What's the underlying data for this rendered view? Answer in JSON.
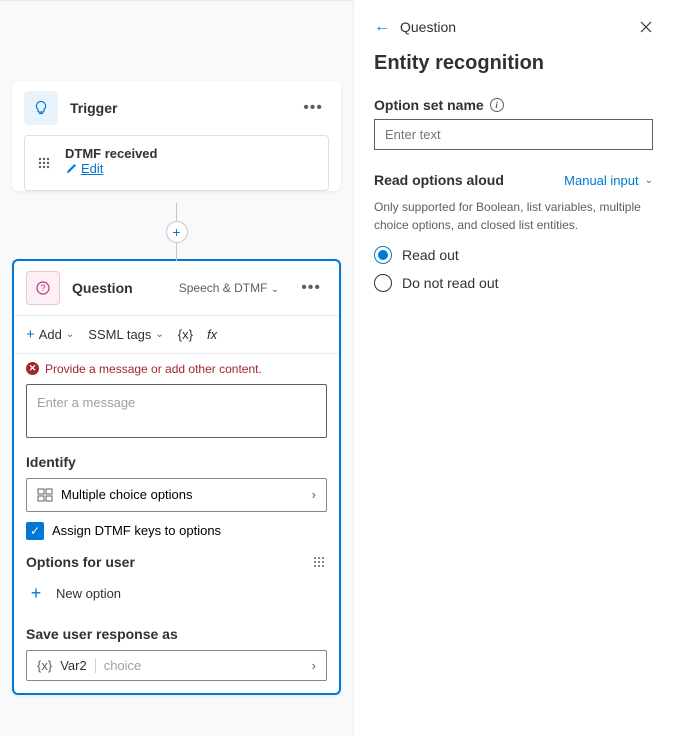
{
  "trigger": {
    "title": "Trigger",
    "event": "DTMF received",
    "edit": "Edit"
  },
  "question": {
    "title": "Question",
    "mode": "Speech & DTMF",
    "toolbar": {
      "add": "Add",
      "ssml": "SSML tags",
      "var": "{x}",
      "fx": "fx"
    },
    "error": "Provide a message or add other content.",
    "message_placeholder": "Enter a message",
    "identify_label": "Identify",
    "identify_value": "Multiple choice options",
    "assign_dtmf": "Assign DTMF keys to options",
    "options_label": "Options for user",
    "new_option": "New option",
    "save_label": "Save user response as",
    "var_name": "Var2",
    "var_type": "choice"
  },
  "panel": {
    "breadcrumb": "Question",
    "title": "Entity recognition",
    "option_set_label": "Option set name",
    "option_set_placeholder": "Enter text",
    "read_label": "Read options aloud",
    "manual": "Manual input",
    "help": "Only supported for Boolean, list variables, multiple choice options, and closed list entities.",
    "radio_read": "Read out",
    "radio_noread": "Do not read out"
  }
}
